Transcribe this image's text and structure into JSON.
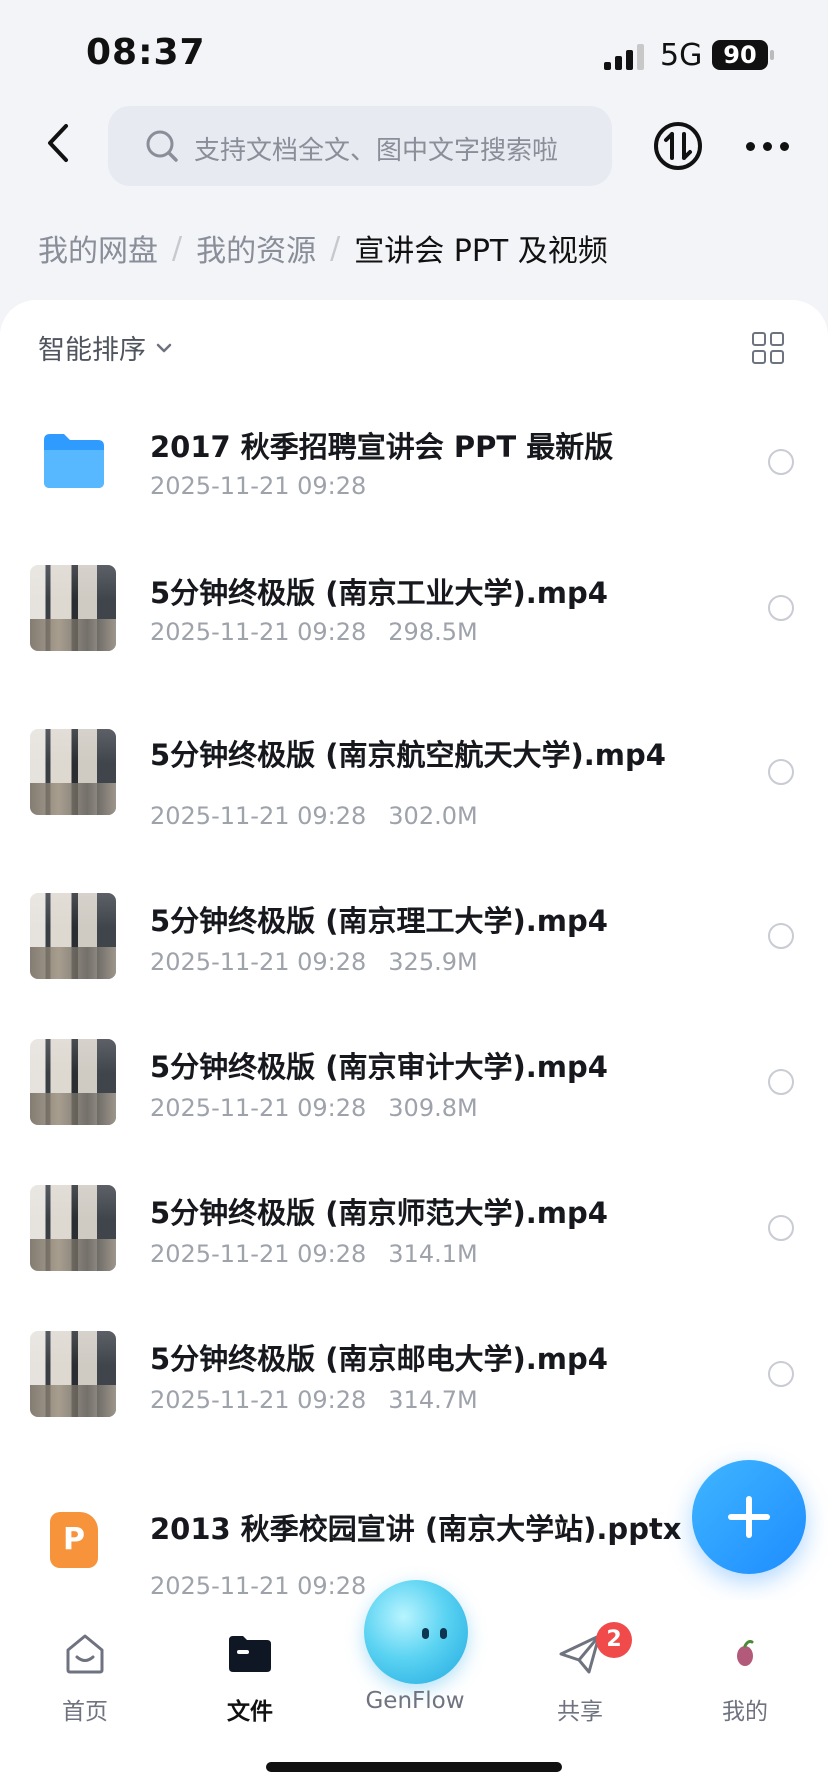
{
  "status_bar": {
    "time": "08:37",
    "network": "5G",
    "battery": "90"
  },
  "top_nav": {
    "search_placeholder": "支持文档全文、图中文字搜索啦",
    "icons": [
      "back-icon",
      "search-icon",
      "sort-circle-icon",
      "more-icon"
    ]
  },
  "breadcrumb": {
    "items": [
      "我的网盘",
      "我的资源",
      "宣讲会 PPT 及视频"
    ],
    "separator": "/"
  },
  "toolbar": {
    "sort_label": "智能排序"
  },
  "files": [
    {
      "type": "folder",
      "name": "2017 秋季招聘宣讲会 PPT 最新版",
      "date": "2025-11-21 09:28",
      "size": ""
    },
    {
      "type": "video",
      "name": "5分钟终极版 (南京工业大学).mp4",
      "date": "2025-11-21 09:28",
      "size": "298.5M"
    },
    {
      "type": "video",
      "name": "5分钟终极版 (南京航空航天大学).mp4",
      "date": "2025-11-21 09:28",
      "size": "302.0M"
    },
    {
      "type": "video",
      "name": "5分钟终极版 (南京理工大学).mp4",
      "date": "2025-11-21 09:28",
      "size": "325.9M"
    },
    {
      "type": "video",
      "name": "5分钟终极版 (南京审计大学).mp4",
      "date": "2025-11-21 09:28",
      "size": "309.8M"
    },
    {
      "type": "video",
      "name": "5分钟终极版 (南京师范大学).mp4",
      "date": "2025-11-21 09:28",
      "size": "314.1M"
    },
    {
      "type": "video",
      "name": "5分钟终极版 (南京邮电大学).mp4",
      "date": "2025-11-21 09:28",
      "size": "314.7M"
    },
    {
      "type": "pptx",
      "name": "2013 秋季校园宣讲 (南京大学站).pptx",
      "date": "2025-11-21 09:28",
      "size": ""
    }
  ],
  "tabbar": {
    "tabs": [
      {
        "label": "首页",
        "icon": "home-icon"
      },
      {
        "label": "文件",
        "icon": "folder-icon"
      },
      {
        "label": "GenFlow",
        "icon": "genflow-orb-icon"
      },
      {
        "label": "共享",
        "icon": "share-plane-icon",
        "badge": "2"
      },
      {
        "label": "我的",
        "icon": "avatar-icon"
      }
    ],
    "active": "文件"
  },
  "colors": {
    "accent": "#1e8cff",
    "badge": "#f04a4a",
    "folder": "#2f9bff",
    "pptx": "#f7933a"
  }
}
